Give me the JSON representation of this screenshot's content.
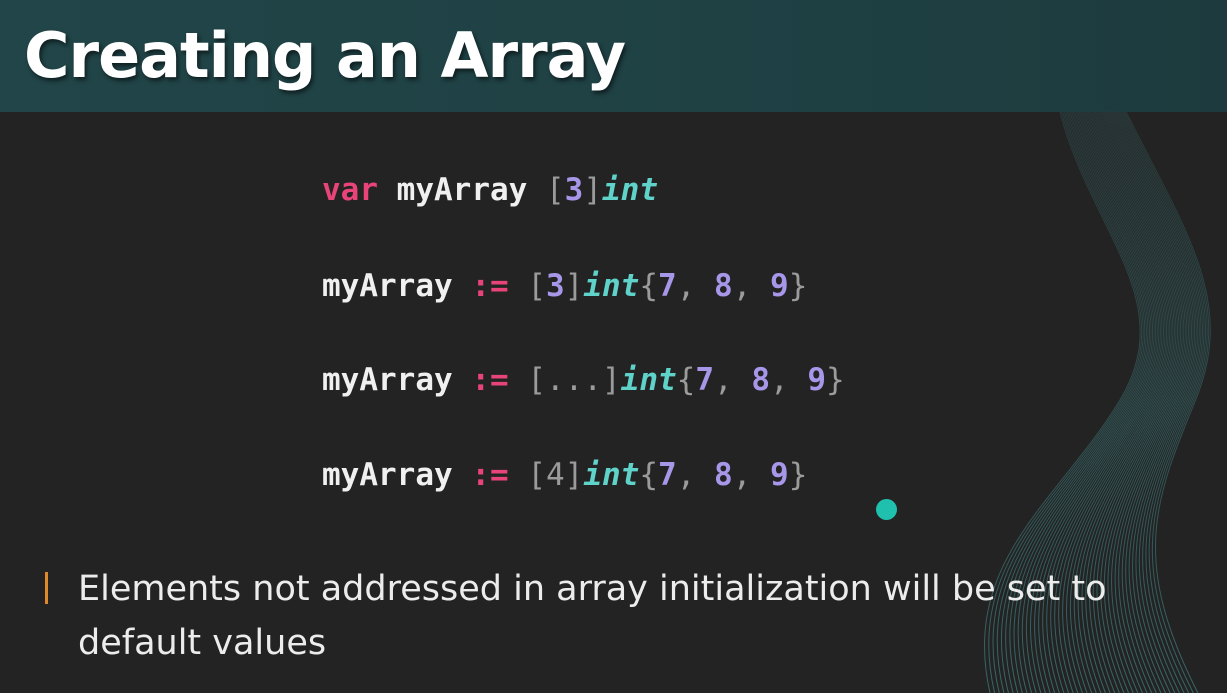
{
  "slide": {
    "title": "Creating an Array",
    "bullet": "Elements not addressed in array initialization will be set to default values"
  },
  "code": {
    "line1": {
      "keyword": "var",
      "name": "myArray",
      "open": "[",
      "size": "3",
      "close": "]",
      "type": "int"
    },
    "line2": {
      "name": "myArray",
      "op": ":=",
      "open": "[",
      "size": "3",
      "close": "]",
      "type": "int",
      "brace_open": "{",
      "v1": "7",
      "sep1": ",",
      "v2": "8",
      "sep2": ",",
      "v3": "9",
      "brace_close": "}"
    },
    "line3": {
      "name": "myArray",
      "op": ":=",
      "open": "[",
      "size": "...",
      "close": "]",
      "type": "int",
      "brace_open": "{",
      "v1": "7",
      "sep1": ",",
      "v2": "8",
      "sep2": ",",
      "v3": "9",
      "brace_close": "}"
    },
    "line4": {
      "name": "myArray",
      "op": ":=",
      "open": "[",
      "size": "4",
      "close": "]",
      "type": "int",
      "brace_open": "{",
      "v1": "7",
      "sep1": ",",
      "v2": "8",
      "sep2": ",",
      "v3": "9",
      "brace_close": "}"
    }
  },
  "colors": {
    "header_band": "#214548",
    "background": "#232323",
    "keyword": "#e8447a",
    "type": "#5fd2c9",
    "number": "#a896e8",
    "cursor_dot": "#1fc0ae",
    "bullet_bar": "#e0892a"
  }
}
